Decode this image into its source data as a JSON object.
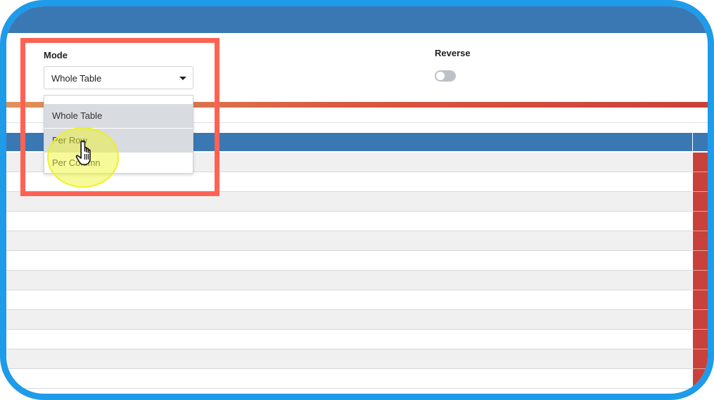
{
  "filter": {
    "mode_label": "Mode",
    "mode_value": "Whole Table",
    "reverse_label": "Reverse",
    "reverse_on": false
  },
  "dropdown": {
    "options": [
      {
        "label": "Whole Table"
      },
      {
        "label": "Per Row"
      },
      {
        "label": "Per Column"
      }
    ]
  },
  "colors": {
    "accent_blue": "#3a78b4",
    "frame_blue": "#1e9be9",
    "highlight_red": "#ff6253",
    "cursor_halo_yellow": "#eef528",
    "heat_red": "#c8413a"
  },
  "icons": {
    "dropdown_caret": "caret-down-icon",
    "pointer": "hand-cursor-icon"
  }
}
